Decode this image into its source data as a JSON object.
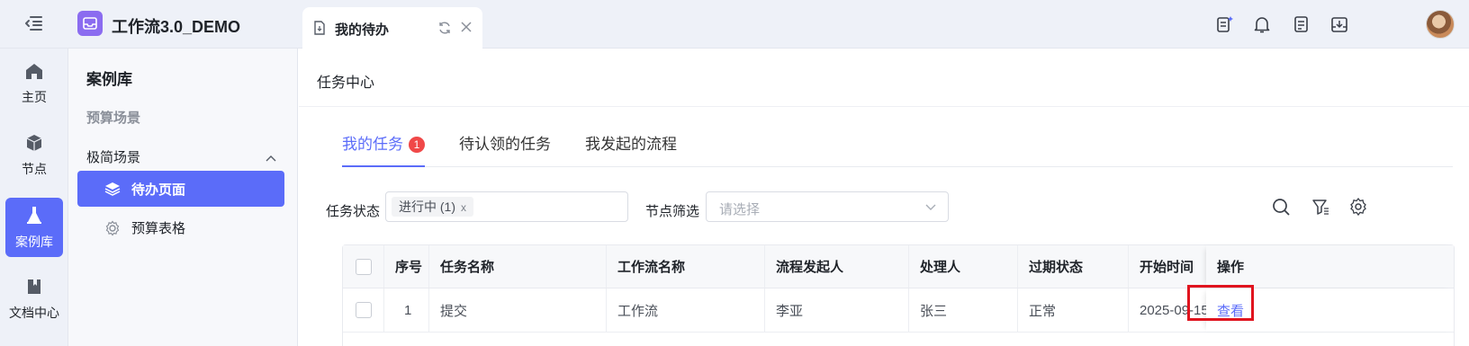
{
  "app": {
    "title": "工作流3.0_DEMO",
    "accent": "#5b6cf9",
    "logo_color": "#8b6cf0"
  },
  "open_tab": {
    "label": "我的待办"
  },
  "header_icons": [
    "ai-doc-icon",
    "bell-icon",
    "document-list-icon",
    "download-box-icon"
  ],
  "rail": {
    "items": [
      {
        "label": "主页",
        "icon": "home-icon"
      },
      {
        "label": "节点",
        "icon": "cube-icon"
      },
      {
        "label": "案例库",
        "icon": "flask-icon",
        "active": true
      },
      {
        "label": "文档中心",
        "icon": "book-icon"
      }
    ]
  },
  "sidebar": {
    "title": "案例库",
    "category": "预算场景",
    "group": "极简场景",
    "items": [
      {
        "label": "待办页面",
        "icon": "layers-icon",
        "active": true
      },
      {
        "label": "预算表格",
        "icon": "gear-icon"
      }
    ]
  },
  "main": {
    "page_title": "任务中心",
    "tabs": [
      {
        "label": "我的任务",
        "badge": "1",
        "active": true
      },
      {
        "label": "待认领的任务"
      },
      {
        "label": "我发起的流程"
      }
    ],
    "filters": {
      "status_label": "任务状态",
      "status_chip": "进行中 (1)",
      "status_chip_close": "x",
      "node_label": "节点筛选",
      "node_placeholder": "请选择"
    },
    "table": {
      "headers": [
        "序号",
        "任务名称",
        "工作流名称",
        "流程发起人",
        "处理人",
        "过期状态",
        "开始时间",
        "操作"
      ],
      "rows": [
        {
          "index": "1",
          "task": "提交",
          "workflow": "工作流",
          "initiator": "李亚",
          "handler": "张三",
          "expiry": "正常",
          "start": "2025-09-15",
          "action": "查看"
        }
      ]
    }
  }
}
